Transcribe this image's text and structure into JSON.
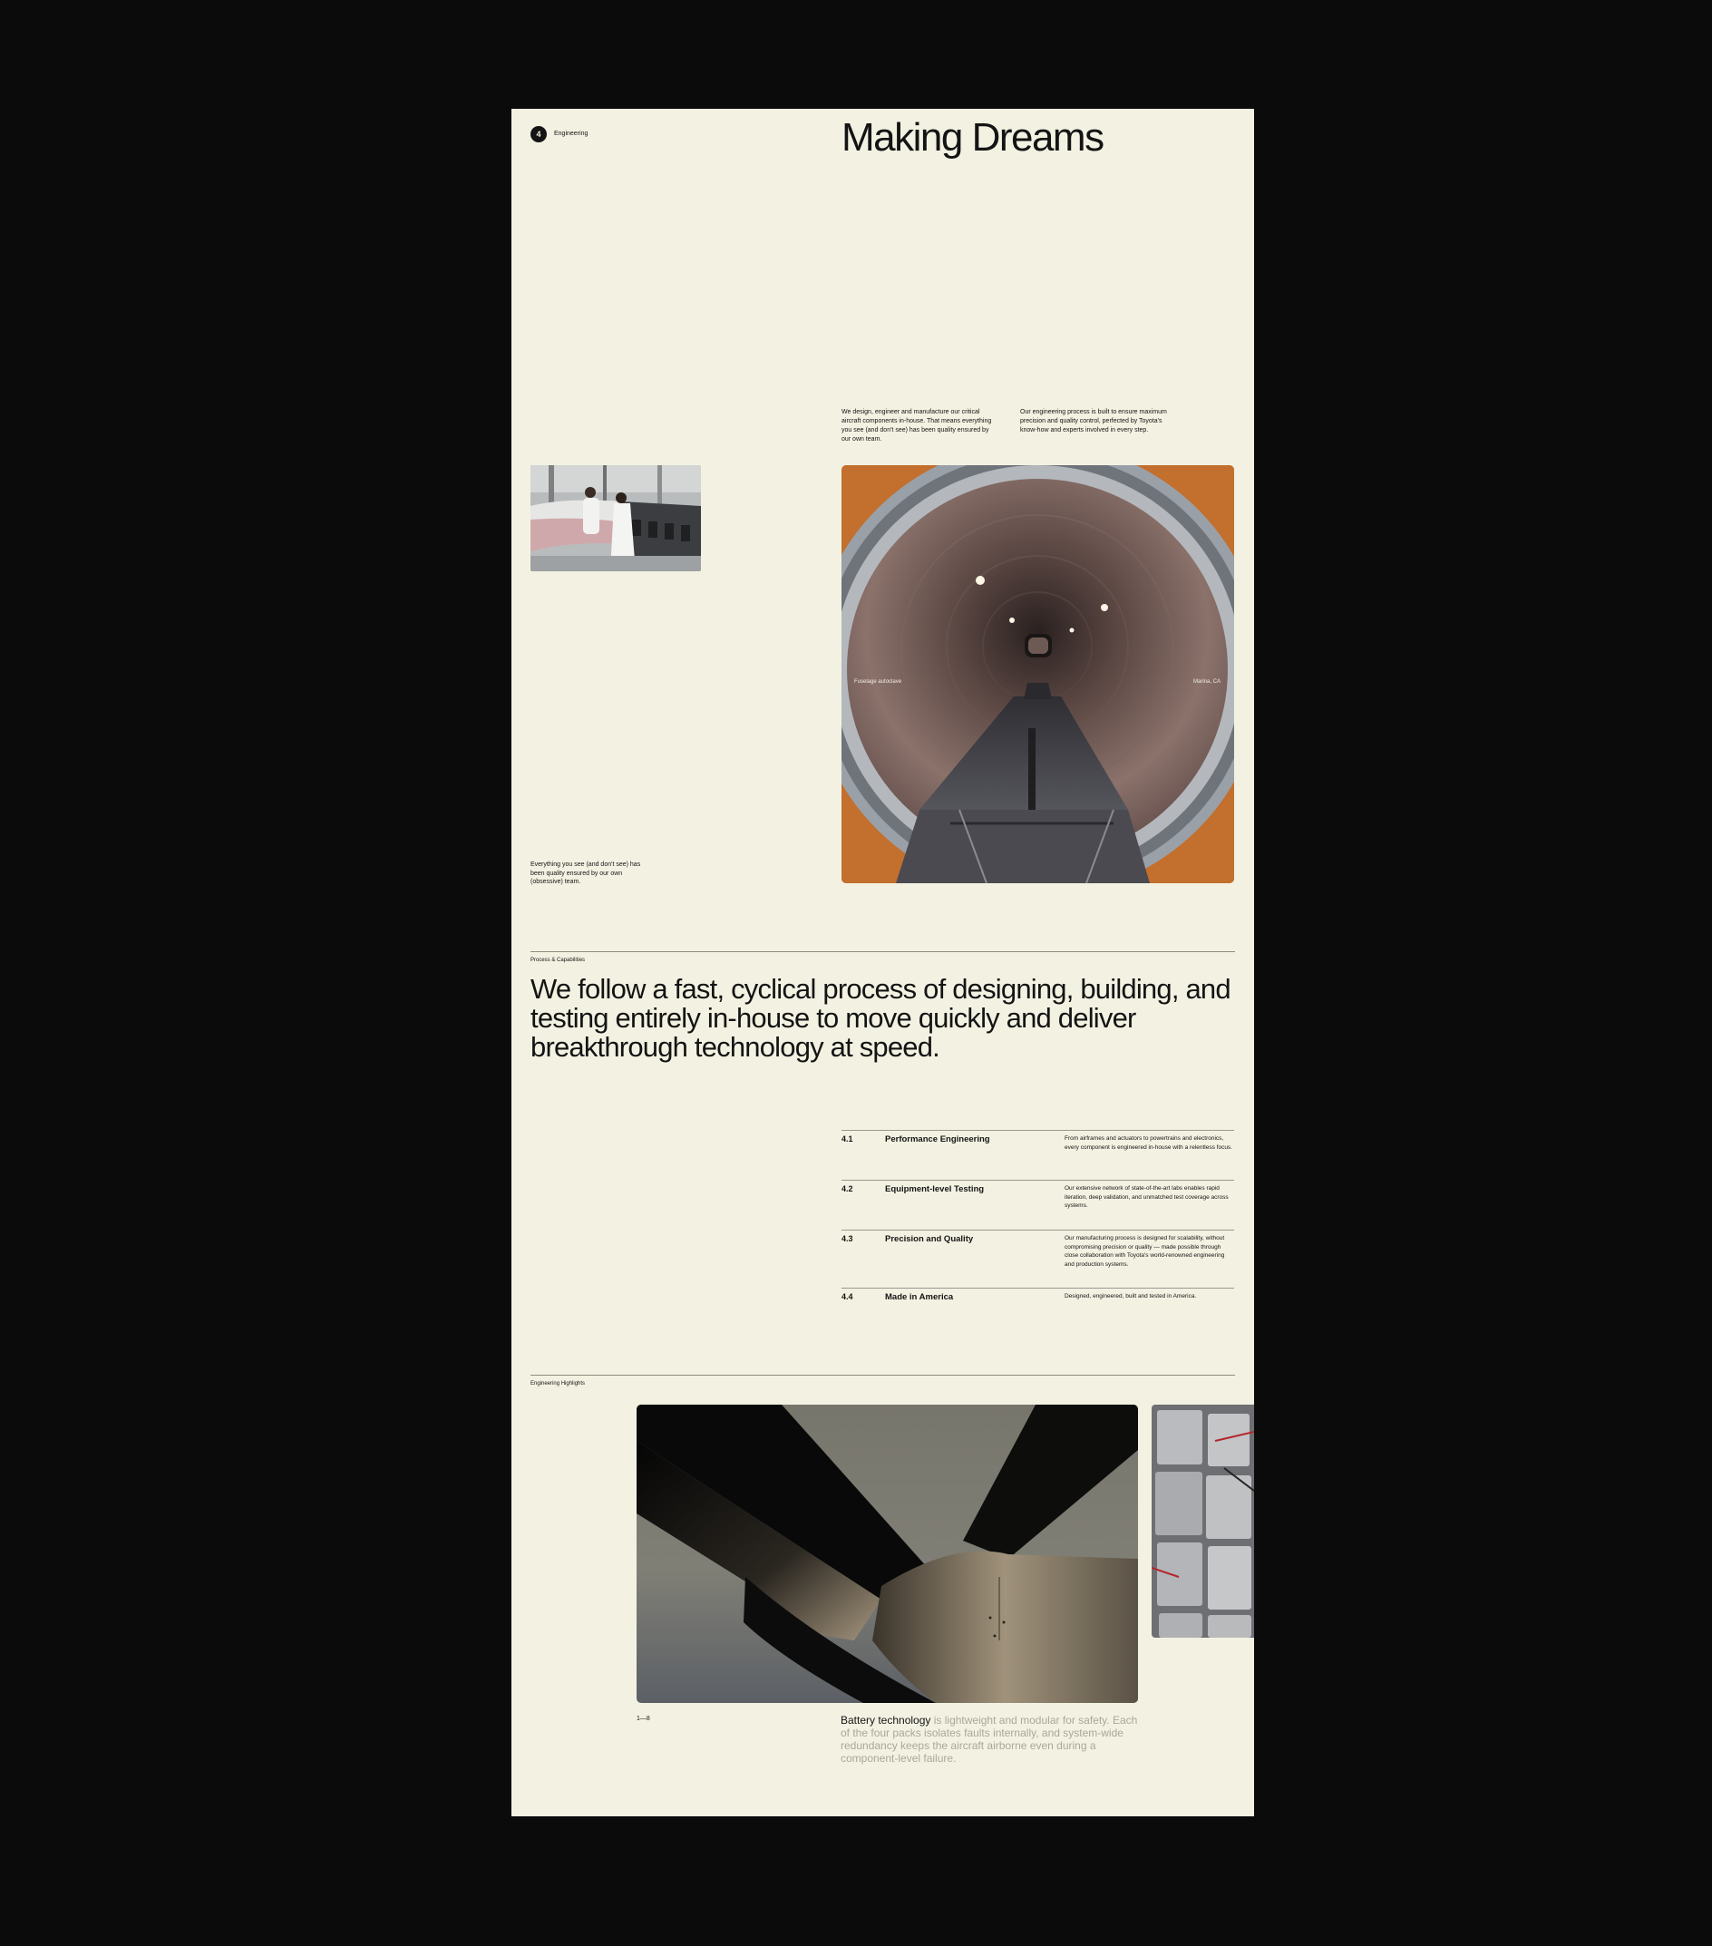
{
  "section": {
    "number": "4",
    "label": "Engineering"
  },
  "hero": {
    "title": "Making Dreams"
  },
  "intro": {
    "paragraph_1": "We design, engineer and manufacture our critical aircraft components in-house. That means everything you see (and don't see) has been quality ensured by our own team.",
    "paragraph_2": "Our engineering process is built to ensure maximum precision and quality control, perfected by Toyota's know-how and experts involved in every step."
  },
  "gallery": {
    "small_caption": "Everything you see (and don't see) has been quality ensured by our own (obsessive) team.",
    "tunnel_label_left": "Fuselage autoclave",
    "tunnel_label_right": "Marina, CA"
  },
  "process": {
    "kicker": "Process & Capabilities",
    "statement": "We follow a fast, cyclical process of designing, building, and testing entirely in-house to move quickly  and deliver breakthrough technology at speed.",
    "items": [
      {
        "number": "4.1",
        "title": "Performance Engineering",
        "description": "From airframes and actuators to powertrains and electronics, every component is engineered in-house with a relentless focus."
      },
      {
        "number": "4.2",
        "title": "Equipment-level Testing",
        "description": "Our extensive network of state-of-the-art labs enables rapid iteration, deep validation, and unmatched test coverage across systems."
      },
      {
        "number": "4.3",
        "title": "Precision and Quality",
        "description": "Our manufacturing process is designed for scalability, without compromising precision or quality — made possible through close collaboration with Toyota's world-renowned engineering and production systems."
      },
      {
        "number": "4.4",
        "title": "Made in America",
        "description": "Designed, engineered, built and tested in America."
      }
    ]
  },
  "highlights": {
    "kicker": "Engineering Highlights",
    "counter": "1—8",
    "caption_lead": "Battery technology",
    "caption_rest": " is lightweight and modular for safety. Each of the four packs isolates faults internally, and system-wide redundancy keeps the aircraft airborne even during a component-level failure."
  },
  "colors": {
    "page_background": "#f3f2e2",
    "outer_background": "#0b0b0b",
    "ink": "#141414",
    "muted_text": "#a9a799"
  }
}
